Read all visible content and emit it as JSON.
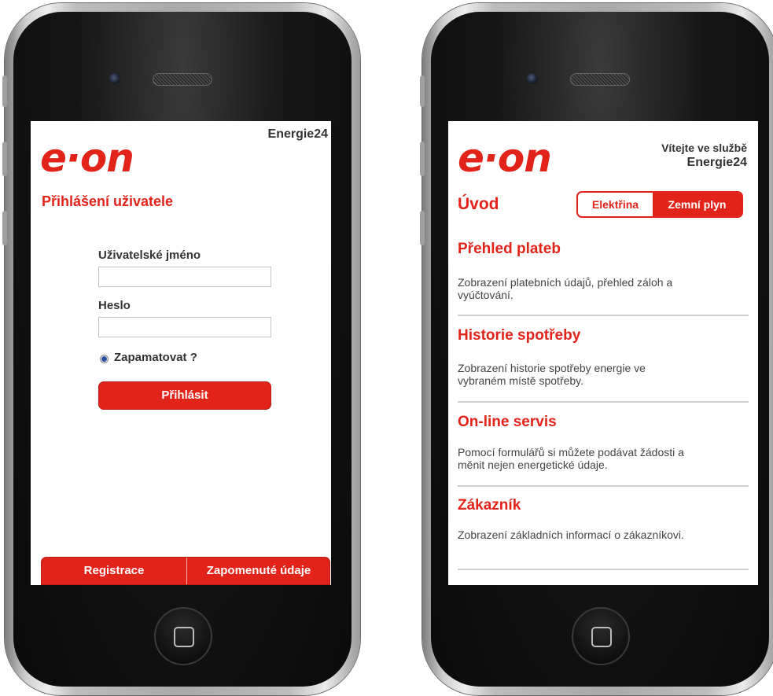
{
  "left_screen": {
    "brand_logo": "e·on",
    "app_title": "Energie24",
    "page_title": "Přihlášení uživatele",
    "username_label": "Uživatelské jméno",
    "username_value": "",
    "password_label": "Heslo",
    "password_value": "",
    "remember_label": "Zapamatovat ?",
    "login_button": "Přihlásit",
    "register_button": "Registrace",
    "forgot_button": "Zapomenuté údaje"
  },
  "right_screen": {
    "brand_logo": "e·on",
    "welcome_line1": "Vítejte ve službě",
    "welcome_line2": "Energie24",
    "page_title": "Úvod",
    "segment_electricity": "Elektřina",
    "segment_gas": "Zemní plyn",
    "sections": [
      {
        "title": "Přehled plateb",
        "desc_line1": "Zobrazení platebních údajů, přehled záloh a",
        "desc_line2": "vyúčtování."
      },
      {
        "title": "Historie spotřeby",
        "desc_line1": "Zobrazení historie spotřeby energie ve",
        "desc_line2": "vybraném místě spotřeby."
      },
      {
        "title": "On-line servis",
        "desc_line1": "Pomocí formulářů si můžete podávat žádosti a",
        "desc_line2": "měnit nejen energetické údaje."
      },
      {
        "title": "Zákazník",
        "desc_line1": "Zobrazení základních informací o zákazníkovi.",
        "desc_line2": ""
      }
    ]
  },
  "colors": {
    "brand_red": "#e2231a",
    "text_gray": "#444444",
    "divider": "#cfcfcf"
  }
}
